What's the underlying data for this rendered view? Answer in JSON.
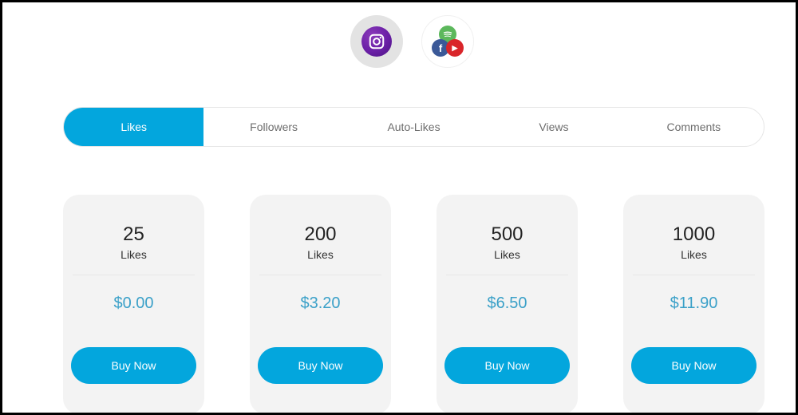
{
  "platforms": [
    {
      "name": "Instagram",
      "icon": "instagram-icon",
      "selected": true
    },
    {
      "name": "Other platforms",
      "icons": [
        "spotify-icon",
        "facebook-icon",
        "youtube-icon"
      ],
      "selected": false
    }
  ],
  "icon_glyphs": {
    "facebook": "f",
    "youtube": "▶"
  },
  "tabs": [
    {
      "label": "Likes",
      "active": true
    },
    {
      "label": "Followers",
      "active": false
    },
    {
      "label": "Auto-Likes",
      "active": false
    },
    {
      "label": "Views",
      "active": false
    },
    {
      "label": "Comments",
      "active": false
    }
  ],
  "packages": [
    {
      "quantity": "25",
      "unit": "Likes",
      "price": "$0.00",
      "button": "Buy Now"
    },
    {
      "quantity": "200",
      "unit": "Likes",
      "price": "$3.20",
      "button": "Buy Now"
    },
    {
      "quantity": "500",
      "unit": "Likes",
      "price": "$6.50",
      "button": "Buy Now"
    },
    {
      "quantity": "1000",
      "unit": "Likes",
      "price": "$11.90",
      "button": "Buy Now"
    }
  ],
  "colors": {
    "accent": "#03a6dd",
    "price": "#3aa0c8",
    "card_bg": "#f3f3f3",
    "instagram": "#6a1fa6",
    "spotify": "#5cb85c",
    "facebook": "#3b5998",
    "youtube": "#d9252a"
  }
}
